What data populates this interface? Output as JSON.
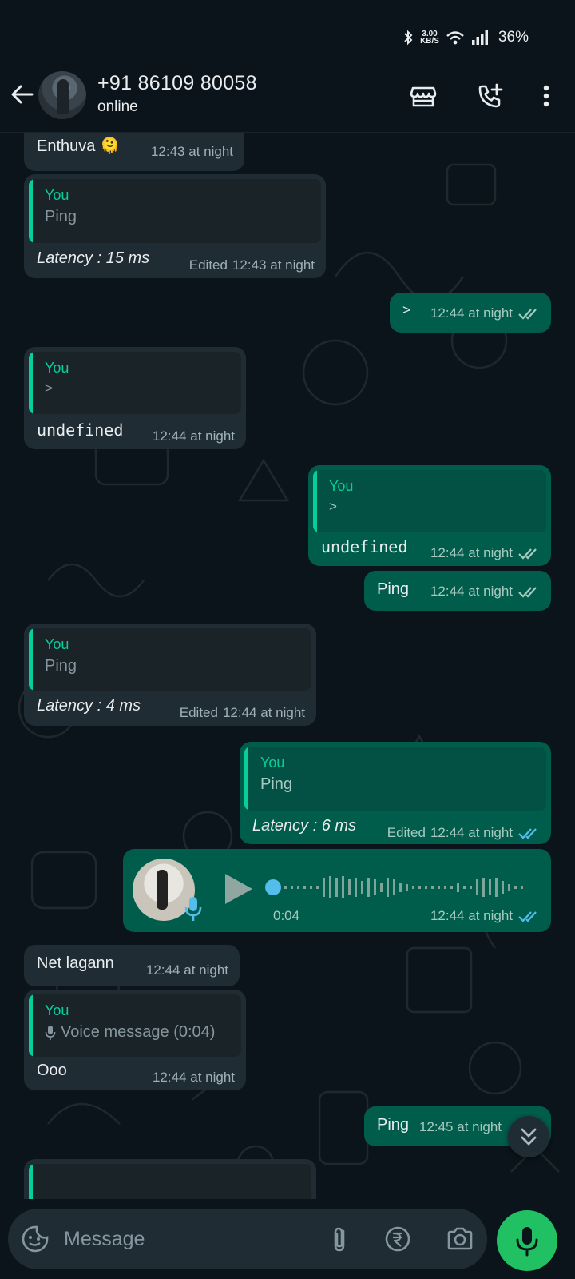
{
  "status_bar": {
    "speed_value": "3.00",
    "speed_unit": "KB/S",
    "battery": "36%"
  },
  "header": {
    "contact_name": "+91 86109 80058",
    "status": "online"
  },
  "messages": [
    {
      "dir": "in",
      "text": "Enthuva 🫠",
      "time": "12:43 at night"
    },
    {
      "dir": "in",
      "quote_author": "You",
      "quote_text": "Ping",
      "text": "Latency : 15 ms",
      "edited": "Edited",
      "time": "12:43 at night"
    },
    {
      "dir": "out",
      "text": ">",
      "time": "12:44 at night",
      "status": "delivered"
    },
    {
      "dir": "in",
      "quote_author": "You",
      "quote_text": ">",
      "text": "undefined",
      "time": "12:44 at night"
    },
    {
      "dir": "out",
      "quote_author": "You",
      "quote_text": ">",
      "text": "undefined",
      "time": "12:44 at night",
      "status": "delivered"
    },
    {
      "dir": "out",
      "text": "Ping",
      "time": "12:44 at night",
      "status": "delivered"
    },
    {
      "dir": "in",
      "quote_author": "You",
      "quote_text": "Ping",
      "text": "Latency : 4 ms",
      "edited": "Edited",
      "time": "12:44 at night"
    },
    {
      "dir": "out",
      "quote_author": "You",
      "quote_text": "Ping",
      "text": "Latency : 6 ms",
      "edited": "Edited",
      "time": "12:44 at night",
      "status": "read"
    },
    {
      "dir": "out",
      "type": "voice",
      "duration": "0:04",
      "time": "12:44 at night",
      "status": "read"
    },
    {
      "dir": "in",
      "text": "Net lagann",
      "time": "12:44 at night"
    },
    {
      "dir": "in",
      "quote_author": "You",
      "quote_text": "Voice message (0:04)",
      "text": "Ooo",
      "time": "12:44 at night"
    },
    {
      "dir": "out",
      "text": "Ping",
      "time": "12:45 at night",
      "status": "delivered"
    }
  ],
  "composer": {
    "placeholder": "Message"
  },
  "colors": {
    "background": "#0b141a",
    "incoming_bubble": "#202c33",
    "outgoing_bubble": "#005c4b",
    "accent_green": "#21c063",
    "quote_bar": "#06cf9c",
    "read_tick": "#53bdeb"
  },
  "icons": {
    "back": "arrow-left-icon",
    "store": "store-icon",
    "call": "add-call-icon",
    "more": "more-vert-icon",
    "emoji": "sticker-icon",
    "attach": "paperclip-icon",
    "payment": "rupee-icon",
    "camera": "camera-icon",
    "mic": "mic-icon",
    "scroll": "double-chevron-down-icon"
  }
}
